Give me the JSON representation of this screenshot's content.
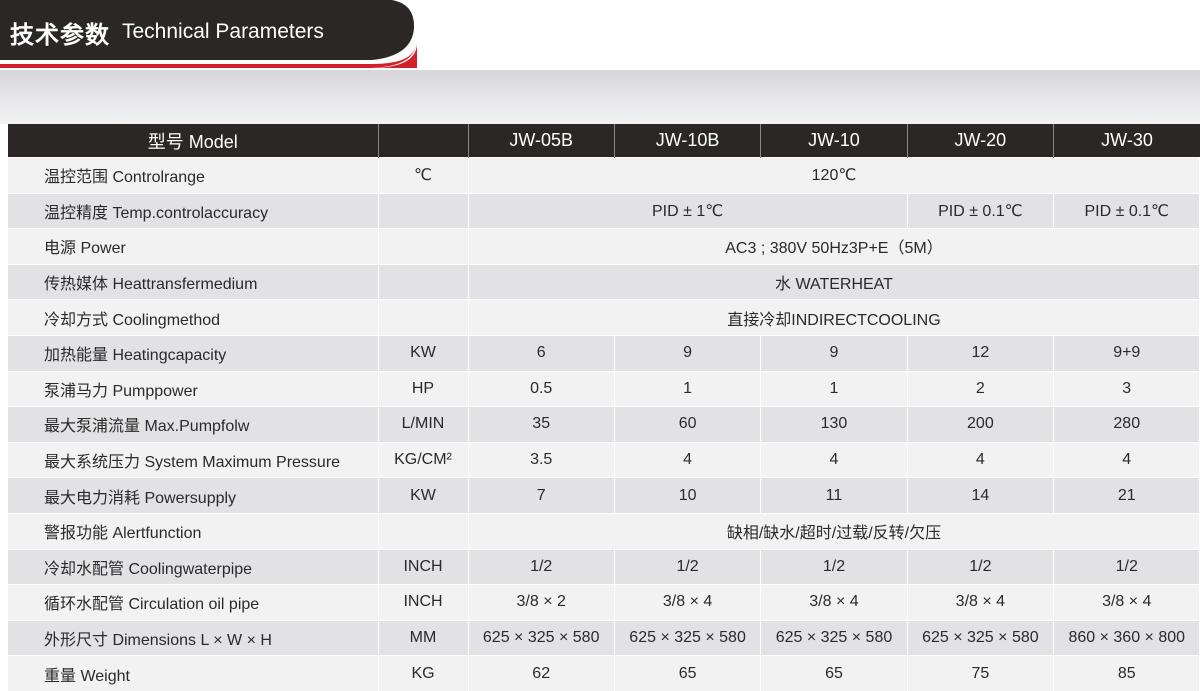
{
  "header": {
    "title_cn": "技术参数",
    "title_en": "Technical Parameters"
  },
  "colors": {
    "banner_dark": "#2b2726",
    "banner_accent": "#d4202c",
    "row_light": "#f2f2f3",
    "row_dark": "#e2e2e4"
  },
  "table": {
    "headers": {
      "name": "型号 Model",
      "unit": "",
      "models": [
        "JW-05B",
        "JW-10B",
        "JW-10",
        "JW-20",
        "JW-30"
      ]
    },
    "rows": [
      {
        "name": "温控范围 Controlrange",
        "unit": "℃",
        "cells": [
          {
            "text": "120℃",
            "span": 5
          }
        ]
      },
      {
        "name": "温控精度 Temp.controlaccuracy",
        "unit": "",
        "cells": [
          {
            "text": "PID ± 1℃",
            "span": 3
          },
          {
            "text": "PID ± 0.1℃",
            "span": 1
          },
          {
            "text": "PID ± 0.1℃",
            "span": 1
          }
        ]
      },
      {
        "name": "电源 Power",
        "unit": "",
        "cells": [
          {
            "text": "AC3 ; 380V 50Hz3P+E（5M）",
            "span": 5
          }
        ]
      },
      {
        "name": "传热媒体 Heattransfermedium",
        "unit": "",
        "cells": [
          {
            "text": "水 WATERHEAT",
            "span": 5
          }
        ]
      },
      {
        "name": "冷却方式 Coolingmethod",
        "unit": "",
        "cells": [
          {
            "text": "直接冷却INDIRECTCOOLING",
            "span": 5
          }
        ]
      },
      {
        "name": "加热能量 Heatingcapacity",
        "unit": "KW",
        "cells": [
          {
            "text": "6"
          },
          {
            "text": "9"
          },
          {
            "text": "9"
          },
          {
            "text": "12"
          },
          {
            "text": "9+9"
          }
        ]
      },
      {
        "name": "泵浦马力 Pumppower",
        "unit": "HP",
        "cells": [
          {
            "text": "0.5"
          },
          {
            "text": "1"
          },
          {
            "text": "1"
          },
          {
            "text": "2"
          },
          {
            "text": "3"
          }
        ]
      },
      {
        "name": "最大泵浦流量 Max.Pumpfolw",
        "unit": "L/MIN",
        "cells": [
          {
            "text": "35"
          },
          {
            "text": "60"
          },
          {
            "text": "130"
          },
          {
            "text": "200"
          },
          {
            "text": "280"
          }
        ]
      },
      {
        "name": "最大系统压力 System Maximum Pressure",
        "unit": "KG/CM²",
        "cells": [
          {
            "text": "3.5"
          },
          {
            "text": "4"
          },
          {
            "text": "4"
          },
          {
            "text": "4"
          },
          {
            "text": "4"
          }
        ]
      },
      {
        "name": "最大电力消耗 Powersupply",
        "unit": "KW",
        "cells": [
          {
            "text": "7"
          },
          {
            "text": "10"
          },
          {
            "text": "11"
          },
          {
            "text": "14"
          },
          {
            "text": "21"
          }
        ]
      },
      {
        "name": "警报功能 Alertfunction",
        "unit": "",
        "cells": [
          {
            "text": "缺相/缺水/超时/过载/反转/欠压",
            "span": 5
          }
        ]
      },
      {
        "name": "冷却水配管 Coolingwaterpipe",
        "unit": "INCH",
        "cells": [
          {
            "text": "1/2"
          },
          {
            "text": "1/2"
          },
          {
            "text": "1/2"
          },
          {
            "text": "1/2"
          },
          {
            "text": "1/2"
          }
        ]
      },
      {
        "name": "循环水配管 Circulation oil pipe",
        "unit": "INCH",
        "cells": [
          {
            "text": "3/8 × 2"
          },
          {
            "text": "3/8 × 4"
          },
          {
            "text": "3/8 × 4"
          },
          {
            "text": "3/8 × 4"
          },
          {
            "text": "3/8 × 4"
          }
        ]
      },
      {
        "name": "外形尺寸 Dimensions L × W × H",
        "unit": "MM",
        "cells": [
          {
            "text": "625 × 325 × 580"
          },
          {
            "text": "625 × 325 × 580"
          },
          {
            "text": "625 × 325 × 580"
          },
          {
            "text": "625 × 325 × 580"
          },
          {
            "text": "860 × 360 × 800"
          }
        ]
      },
      {
        "name": "重量 Weight",
        "unit": "KG",
        "cells": [
          {
            "text": "62"
          },
          {
            "text": "65"
          },
          {
            "text": "65"
          },
          {
            "text": "75"
          },
          {
            "text": "85"
          }
        ]
      }
    ]
  }
}
